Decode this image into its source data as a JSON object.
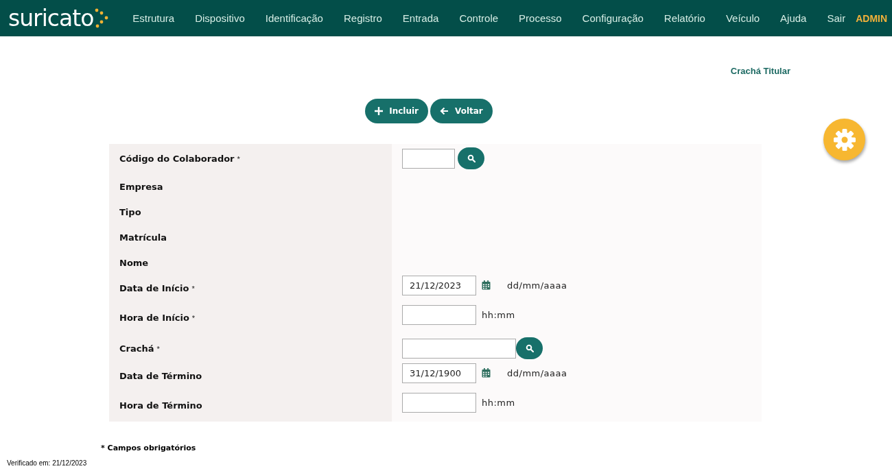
{
  "header": {
    "logo": "suricato",
    "menu": [
      {
        "label": "Estrutura"
      },
      {
        "label": "Dispositivo"
      },
      {
        "label": "Identificação"
      },
      {
        "label": "Registro"
      },
      {
        "label": "Entrada"
      },
      {
        "label": "Controle"
      },
      {
        "label": "Processo"
      },
      {
        "label": "Configuração"
      },
      {
        "label": "Relatório"
      },
      {
        "label": "Veículo"
      },
      {
        "label": "Ajuda"
      },
      {
        "label": "Sair"
      }
    ],
    "user": "ADMIN"
  },
  "page_title": "Crachá Titular",
  "buttons": [
    {
      "kind": "add",
      "label": "Incluir"
    },
    {
      "kind": "back",
      "label": "Voltar"
    }
  ],
  "form": [
    {
      "kind": "lookup",
      "label": "Código do Colaborador",
      "required_mark": "*",
      "wide": false
    },
    {
      "kind": "text",
      "label": "Empresa"
    },
    {
      "kind": "text",
      "label": "Tipo"
    },
    {
      "kind": "text",
      "label": "Matrícula"
    },
    {
      "kind": "text",
      "label": "Nome"
    },
    {
      "kind": "date",
      "label": "Data de Início",
      "required_mark": "*",
      "value": "21/12/2023",
      "hint": "dd/mm/aaaa"
    },
    {
      "kind": "time",
      "label": "Hora de Início",
      "required_mark": "*",
      "hint": "hh:mm"
    },
    {
      "kind": "lookup",
      "label": "Crachá",
      "required_mark": "*",
      "wide": true
    },
    {
      "kind": "date",
      "label": "Data de Término",
      "value": "31/12/1900",
      "hint": "dd/mm/aaaa"
    },
    {
      "kind": "time",
      "label": "Hora de Término",
      "hint": "hh:mm"
    }
  ],
  "footnote": "* Campos obrigatórios",
  "verified": "Verificado em: 21/12/2023"
}
